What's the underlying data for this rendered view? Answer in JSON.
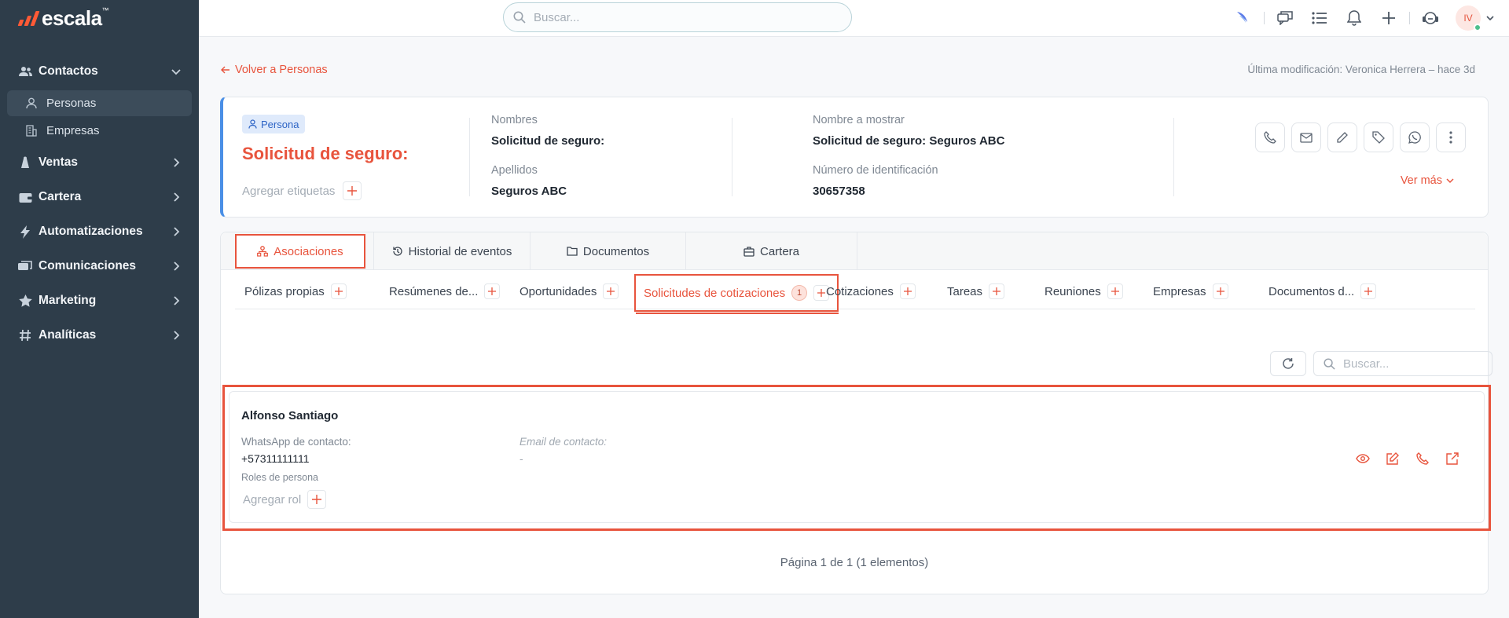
{
  "brand": {
    "name": "escala",
    "tm": "™",
    "accent": "#e8543d",
    "sidebar_bg": "#2e3d4a"
  },
  "sidebar": {
    "items": [
      {
        "label": "Contactos",
        "icon": "users-icon",
        "expanded": true
      },
      {
        "label": "Ventas",
        "icon": "scale-icon"
      },
      {
        "label": "Cartera",
        "icon": "wallet-icon"
      },
      {
        "label": "Automatizaciones",
        "icon": "bolt-icon"
      },
      {
        "label": "Comunicaciones",
        "icon": "chat-icon"
      },
      {
        "label": "Marketing",
        "icon": "star-icon"
      },
      {
        "label": "Analíticas",
        "icon": "hash-icon"
      }
    ],
    "sub_items": [
      {
        "label": "Personas",
        "icon": "person-icon",
        "active": true
      },
      {
        "label": "Empresas",
        "icon": "building-icon"
      }
    ]
  },
  "topbar": {
    "search_placeholder": "Buscar...",
    "avatar_initials": "IV"
  },
  "header": {
    "back_label": "Volver a Personas",
    "last_modified": "Última modificación: Veronica Herrera – hace 3d"
  },
  "record": {
    "badge": "Persona",
    "title": "Solicitud de seguro:",
    "tags_placeholder": "Agregar etiquetas",
    "nombres_label": "Nombres",
    "nombres_value": "Solicitud de seguro:",
    "apellidos_label": "Apellidos",
    "apellidos_value": "Seguros ABC",
    "display_label": "Nombre a mostrar",
    "display_value": "Solicitud de seguro: Seguros ABC",
    "id_label": "Número de identificación",
    "id_value": "30657358",
    "ver_mas": "Ver más"
  },
  "tabs": [
    {
      "label": "Asociaciones",
      "icon": "network-icon",
      "active": true
    },
    {
      "label": "Historial de eventos",
      "icon": "history-icon"
    },
    {
      "label": "Documentos",
      "icon": "folder-icon"
    },
    {
      "label": "Cartera",
      "icon": "briefcase-icon"
    }
  ],
  "subtabs": [
    {
      "label": "Pólizas propias"
    },
    {
      "label": "Resúmenes de..."
    },
    {
      "label": "Oportunidades"
    },
    {
      "label": "Solicitudes de cotizaciones",
      "count": "1",
      "active": true
    },
    {
      "label": "Cotizaciones"
    },
    {
      "label": "Tareas"
    },
    {
      "label": "Reuniones"
    },
    {
      "label": "Empresas"
    },
    {
      "label": "Documentos d..."
    }
  ],
  "list": {
    "search_placeholder": "Buscar...",
    "items": [
      {
        "name": "Alfonso Santiago",
        "whatsapp_label": "WhatsApp de contacto:",
        "whatsapp_value": "+57311111111",
        "email_label": "Email de contacto:",
        "email_value": "-",
        "roles_label": "Roles de persona",
        "add_role": "Agregar rol"
      }
    ],
    "pagination": "Página 1 de 1 (1 elementos)"
  }
}
